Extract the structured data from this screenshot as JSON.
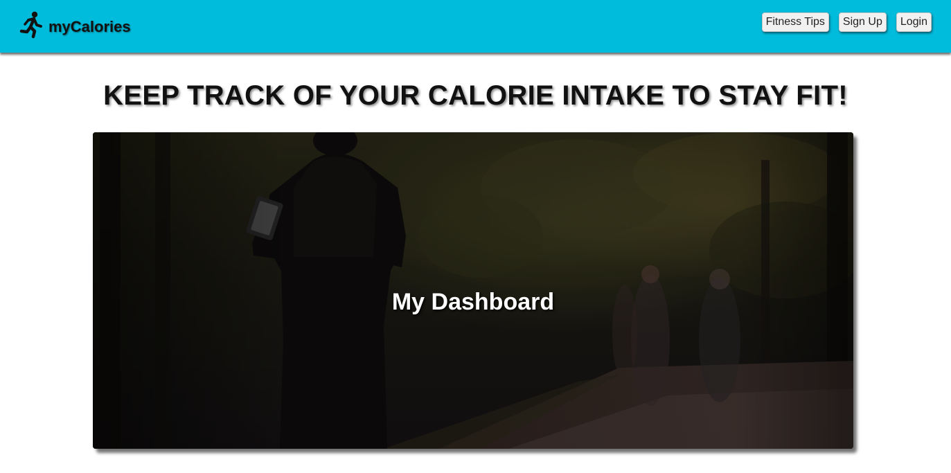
{
  "app": {
    "brand_name": "myCalories",
    "brand_icon": "running-person-icon",
    "accent_color": "#00bcdc"
  },
  "nav": {
    "items": [
      {
        "label": "Fitness Tips"
      },
      {
        "label": "Sign Up"
      },
      {
        "label": "Login"
      }
    ]
  },
  "main": {
    "headline": "KEEP TRACK OF YOUR CALORIE INTAKE TO STAY FIT!",
    "hero": {
      "label": "My Dashboard",
      "image": "runner-in-park-photo"
    }
  }
}
